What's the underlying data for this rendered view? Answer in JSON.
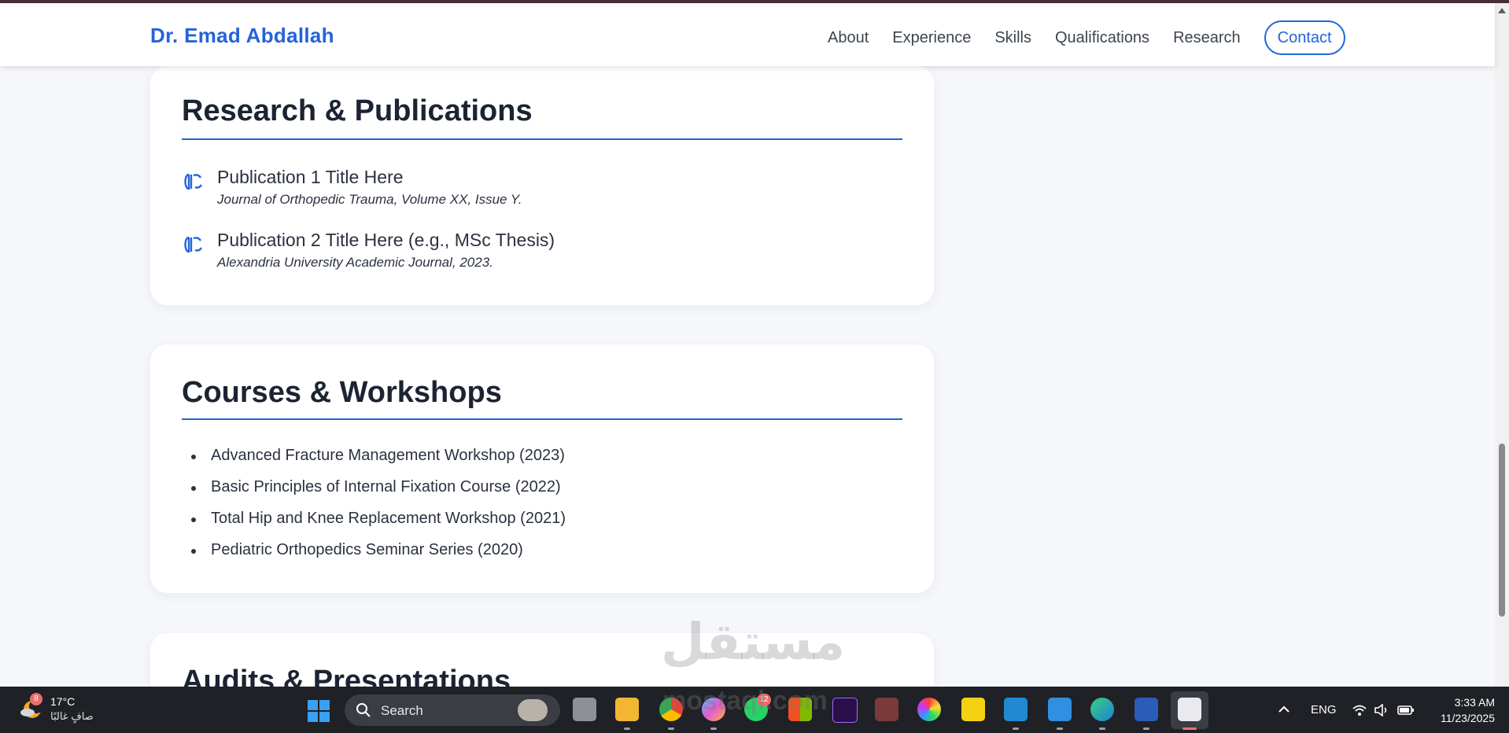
{
  "nav": {
    "brand": "Dr. Emad Abdallah",
    "links": [
      "About",
      "Experience",
      "Skills",
      "Qualifications",
      "Research"
    ],
    "contact": "Contact"
  },
  "research": {
    "heading": "Research & Publications",
    "items": [
      {
        "title": "Publication 1 Title Here",
        "journal": "Journal of Orthopedic Trauma, Volume XX, Issue Y."
      },
      {
        "title": "Publication 2 Title Here (e.g., MSc Thesis)",
        "journal": "Alexandria University Academic Journal, 2023."
      }
    ]
  },
  "courses": {
    "heading": "Courses & Workshops",
    "items": [
      "Advanced Fracture Management Workshop (2023)",
      "Basic Principles of Internal Fixation Course (2022)",
      "Total Hip and Knee Replacement Workshop (2021)",
      "Pediatric Orthopedics Seminar Series (2020)"
    ]
  },
  "audits": {
    "heading": "Audits & Presentations"
  },
  "watermark": {
    "arabic": "مستقل",
    "latin": "mostaql.com"
  },
  "taskbar": {
    "weather_badge": "8",
    "weather_temp": "17°C",
    "weather_desc": "صافٍ غالبًا",
    "search_label": "Search",
    "whatsapp_badge": "12",
    "lang": "ENG",
    "time": "3:33 AM",
    "date": "11/23/2025"
  },
  "colors": {
    "accent": "#2563d9",
    "text": "#2a3140",
    "heading": "#1c2333",
    "background": "#f5f7fb"
  }
}
